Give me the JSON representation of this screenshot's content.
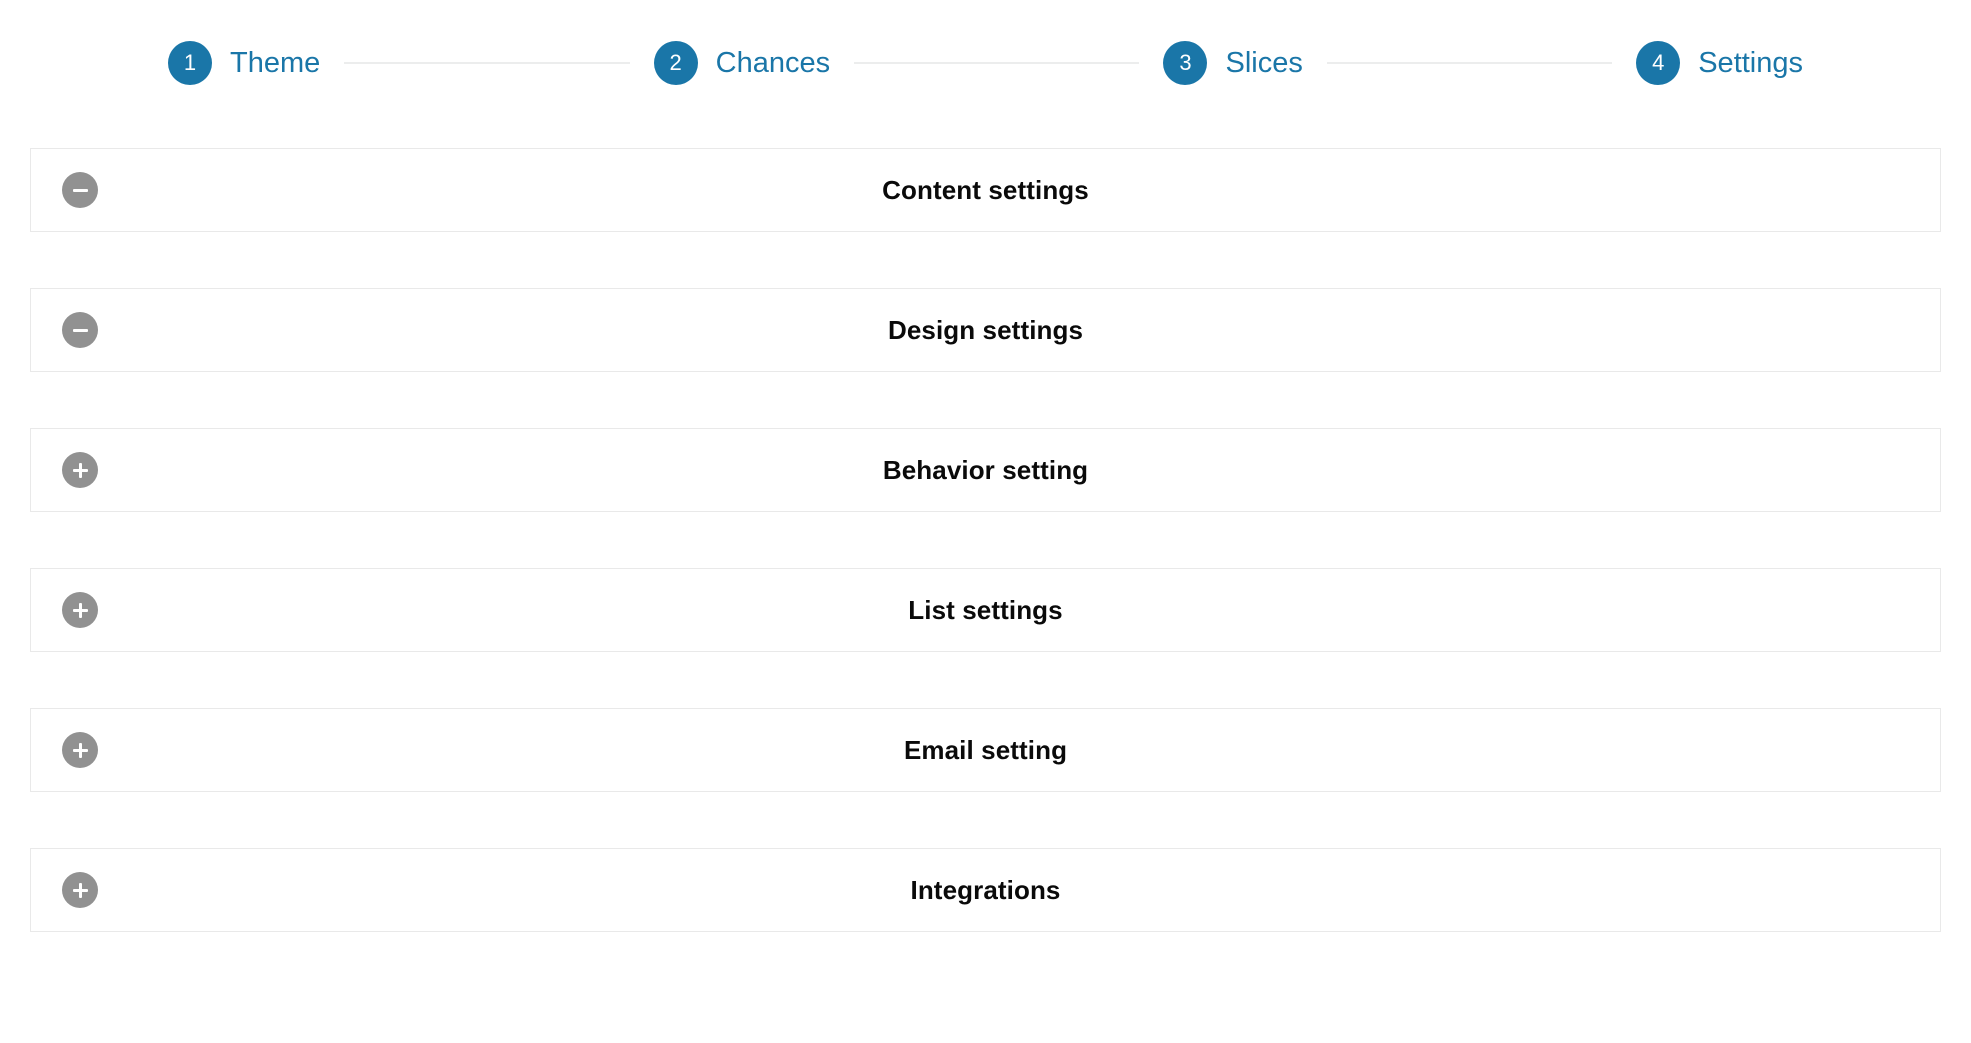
{
  "theme": {
    "accent_blue": "#1a76a8",
    "toggle_gray": "#919191",
    "panel_border": "#e9e9e9",
    "connector_gray": "#eceded",
    "title_color": "#0a0a0a"
  },
  "wizard": {
    "steps": [
      {
        "number": "1",
        "label": "Theme"
      },
      {
        "number": "2",
        "label": "Chances"
      },
      {
        "number": "3",
        "label": "Slices"
      },
      {
        "number": "4",
        "label": "Settings"
      }
    ]
  },
  "panels": [
    {
      "title": "Content settings",
      "state": "expanded",
      "toggle_icon": "minus-icon"
    },
    {
      "title": "Design settings",
      "state": "expanded",
      "toggle_icon": "minus-icon"
    },
    {
      "title": "Behavior setting",
      "state": "collapsed",
      "toggle_icon": "plus-icon"
    },
    {
      "title": "List settings",
      "state": "collapsed",
      "toggle_icon": "plus-icon"
    },
    {
      "title": "Email setting",
      "state": "collapsed",
      "toggle_icon": "plus-icon"
    },
    {
      "title": "Integrations",
      "state": "collapsed",
      "toggle_icon": "plus-icon"
    }
  ]
}
